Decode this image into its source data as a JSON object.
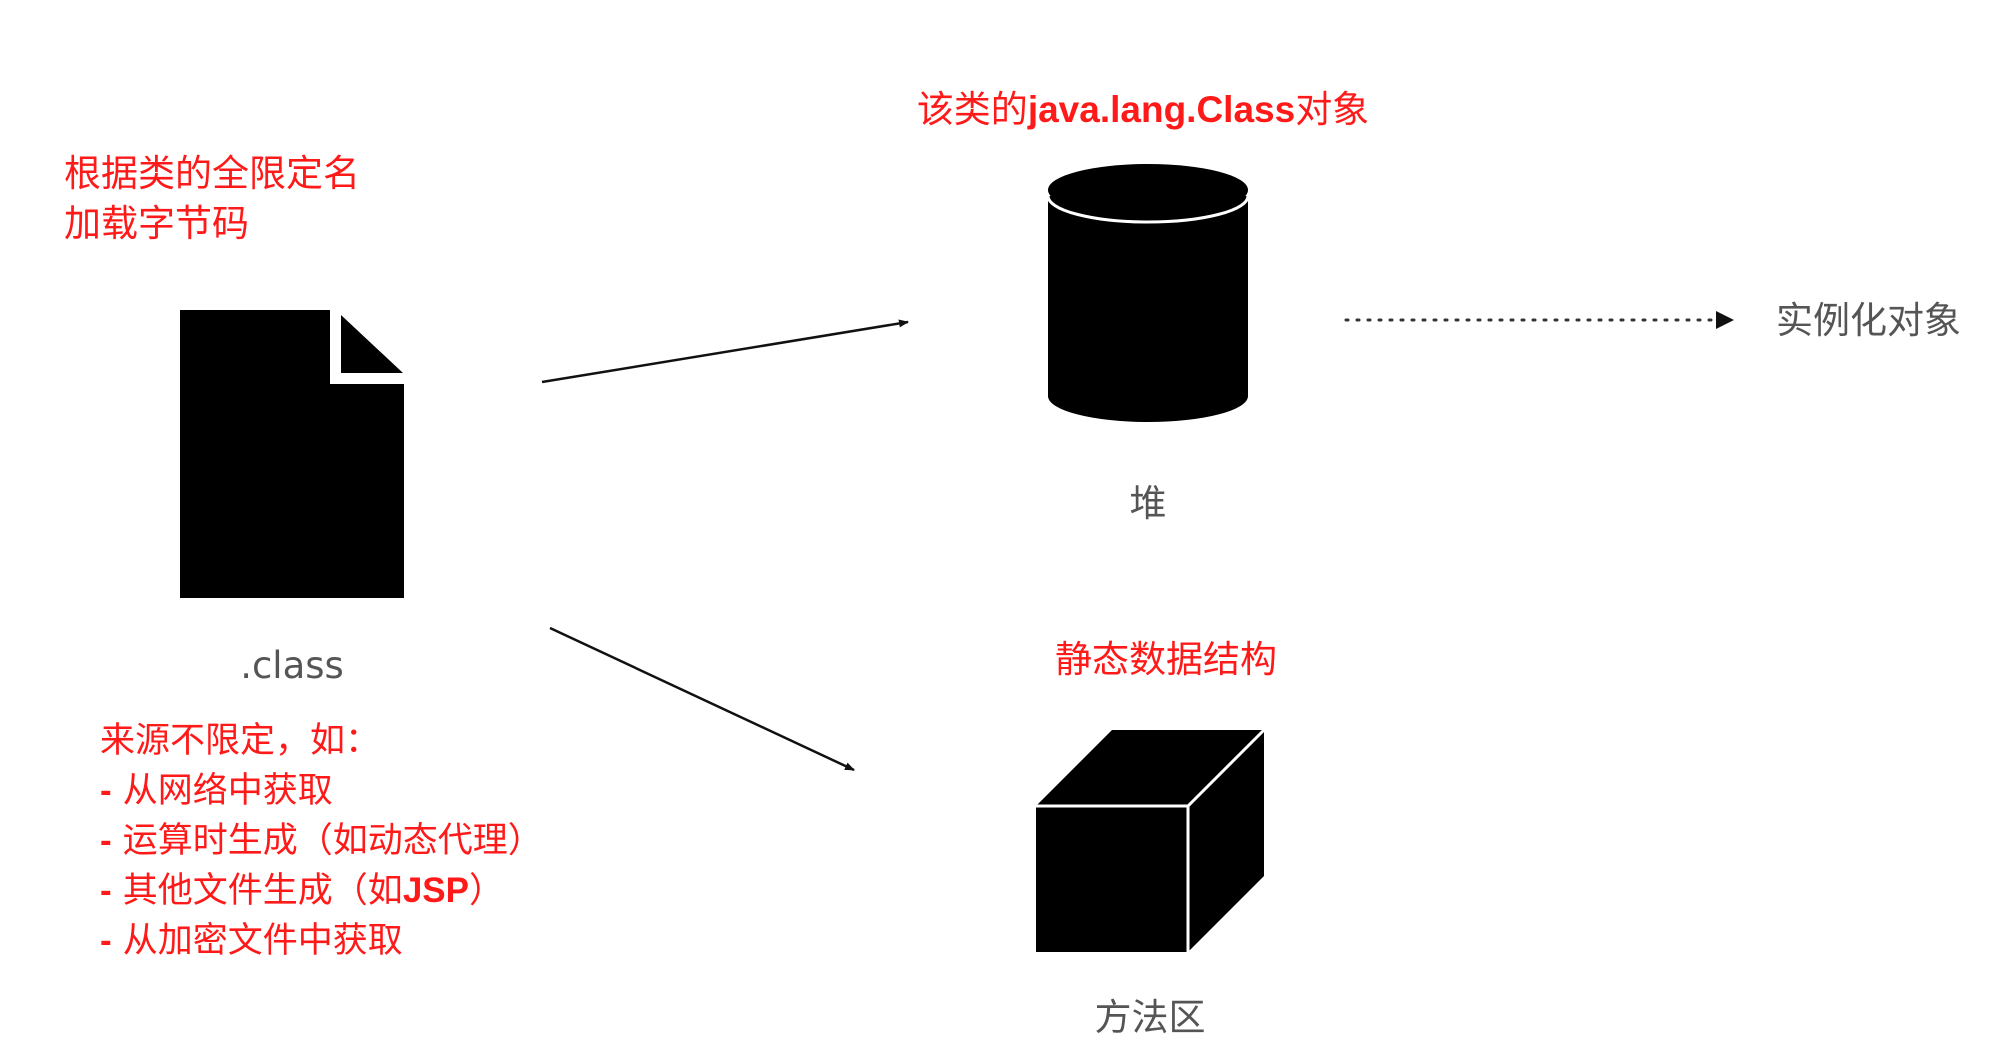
{
  "loader_note": {
    "line1": "根据类的全限定名",
    "line2": "加载字节码"
  },
  "class_file": {
    "label": ".class",
    "icon": "document-icon"
  },
  "sources": {
    "heading": "来源不限定，如：",
    "bullet": "-",
    "items": [
      {
        "text": "从网络中获取"
      },
      {
        "text": "运算时生成（如动态代理）"
      },
      {
        "text_before": "其他文件生成（如",
        "bold": "JSP",
        "text_after": "）"
      },
      {
        "text": "从加密文件中获取"
      }
    ]
  },
  "heap": {
    "caption_prefix": "该类的",
    "caption_bold": "java.lang.Class",
    "caption_suffix": "对象",
    "label": "堆",
    "icon": "cylinder-icon"
  },
  "method_area": {
    "caption": "静态数据结构",
    "label": "方法区",
    "icon": "cube-icon"
  },
  "instance": {
    "label": "实例化对象"
  },
  "colors": {
    "accent_red": "#ff1a1a",
    "label_gray": "#555555",
    "shape_black": "#000000"
  }
}
